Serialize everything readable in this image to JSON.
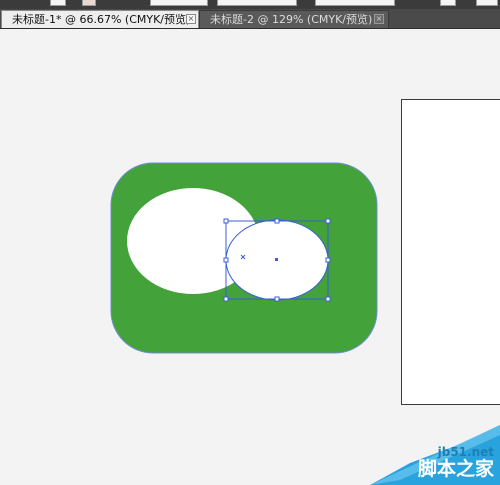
{
  "tabs": [
    {
      "label": "未标题-1* @ 66.67% (CMYK/预览)",
      "active": true
    },
    {
      "label": "未标题-2 @ 129% (CMYK/预览)",
      "active": false
    }
  ],
  "close_glyph": "×",
  "colors": {
    "rounded_rect_fill": "#44a23a",
    "selection": "#3a5fd6",
    "ellipse_fill": "#ffffff"
  },
  "watermark": {
    "site": "jb51.net",
    "name": "脚本之家"
  }
}
